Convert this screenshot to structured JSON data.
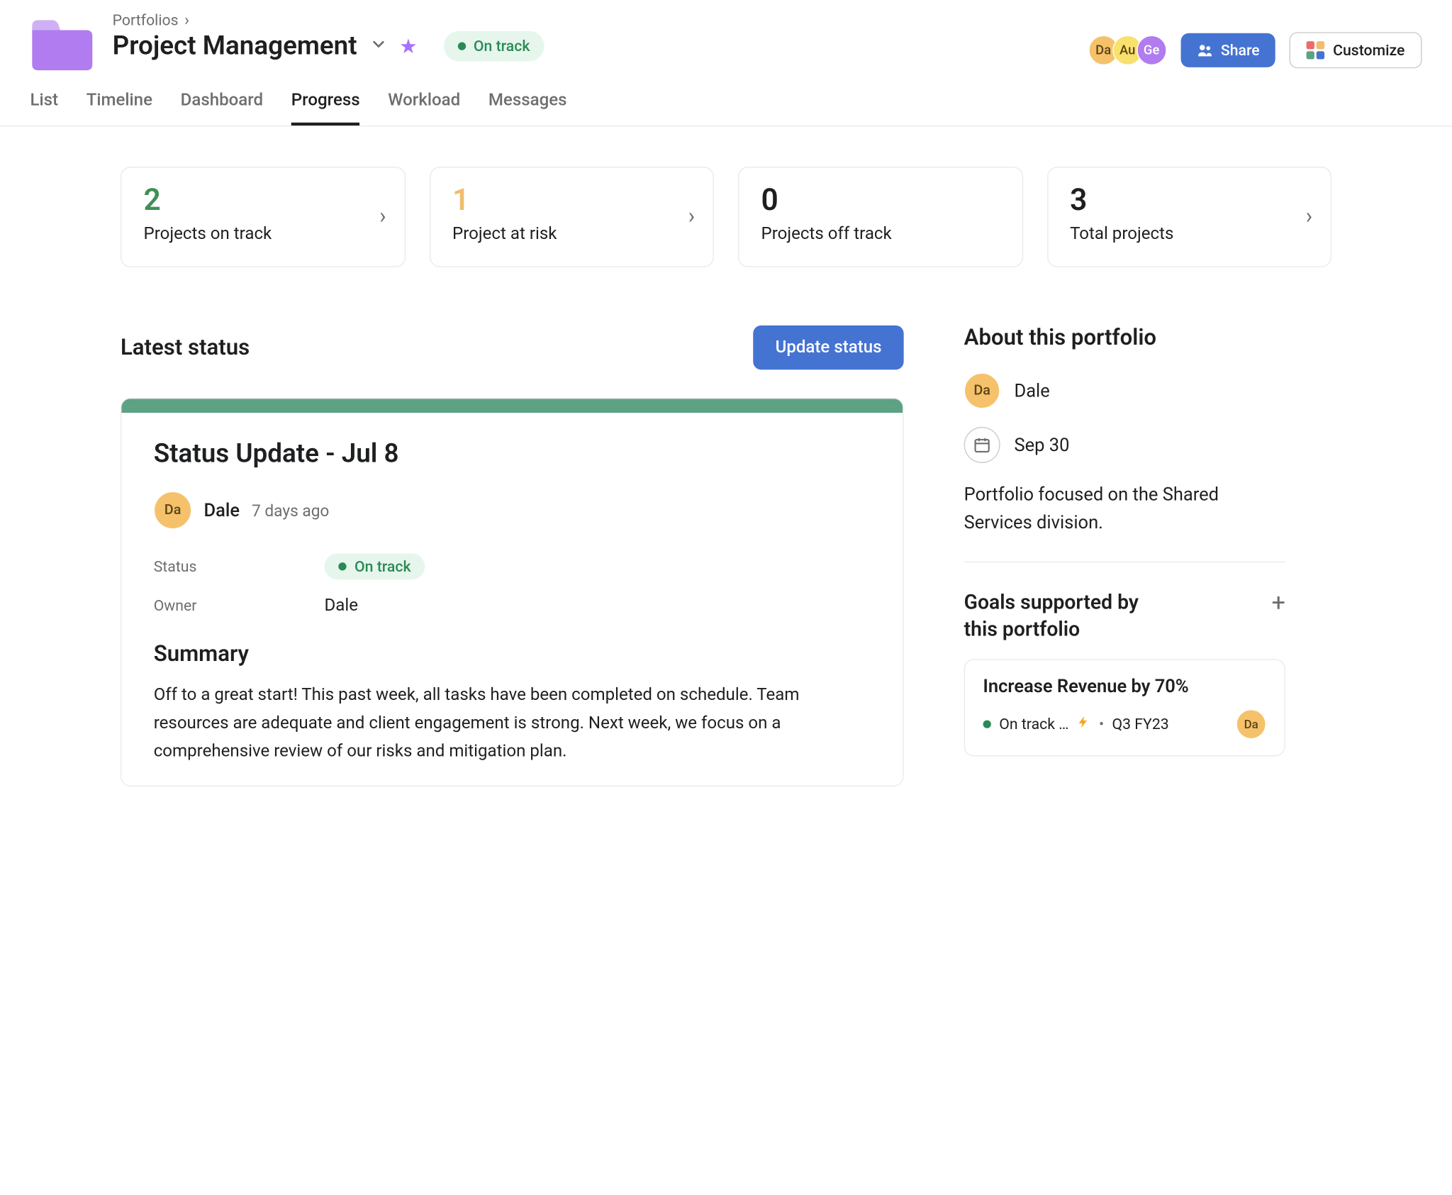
{
  "breadcrumb": {
    "root": "Portfolios"
  },
  "title": "Project Management",
  "header_status": "On track",
  "avatars": [
    "Da",
    "Au",
    "Ge"
  ],
  "share_label": "Share",
  "customize_label": "Customize",
  "tabs": [
    "List",
    "Timeline",
    "Dashboard",
    "Progress",
    "Workload",
    "Messages"
  ],
  "active_tab_index": 3,
  "stats": [
    {
      "value": "2",
      "label": "Projects on track",
      "color": "green",
      "has_chevron": true
    },
    {
      "value": "1",
      "label": "Project at risk",
      "color": "yellow",
      "has_chevron": true
    },
    {
      "value": "0",
      "label": "Projects off track",
      "color": "",
      "has_chevron": false
    },
    {
      "value": "3",
      "label": "Total projects",
      "color": "",
      "has_chevron": true
    }
  ],
  "latest_status": {
    "section_title": "Latest status",
    "update_button": "Update status",
    "title": "Status Update - Jul 8",
    "author_initials": "Da",
    "author_name": "Dale",
    "time_ago": "7 days ago",
    "status_label": "Status",
    "status_value": "On track",
    "owner_label": "Owner",
    "owner_value": "Dale",
    "summary_heading": "Summary",
    "summary_text": "Off to a great start! This past week, all tasks have been completed on schedule. Team resources are adequate and client engagement is strong. Next week, we focus on a comprehensive review of our risks and mitigation plan."
  },
  "about": {
    "heading": "About this portfolio",
    "owner_initials": "Da",
    "owner_name": "Dale",
    "date": "Sep 30",
    "description": "Portfolio focused on the Shared Services division."
  },
  "goals": {
    "heading": "Goals supported by this portfolio",
    "items": [
      {
        "title": "Increase Revenue by 70%",
        "status": "On track …",
        "period": "Q3 FY23",
        "assignee_initials": "Da"
      }
    ]
  }
}
